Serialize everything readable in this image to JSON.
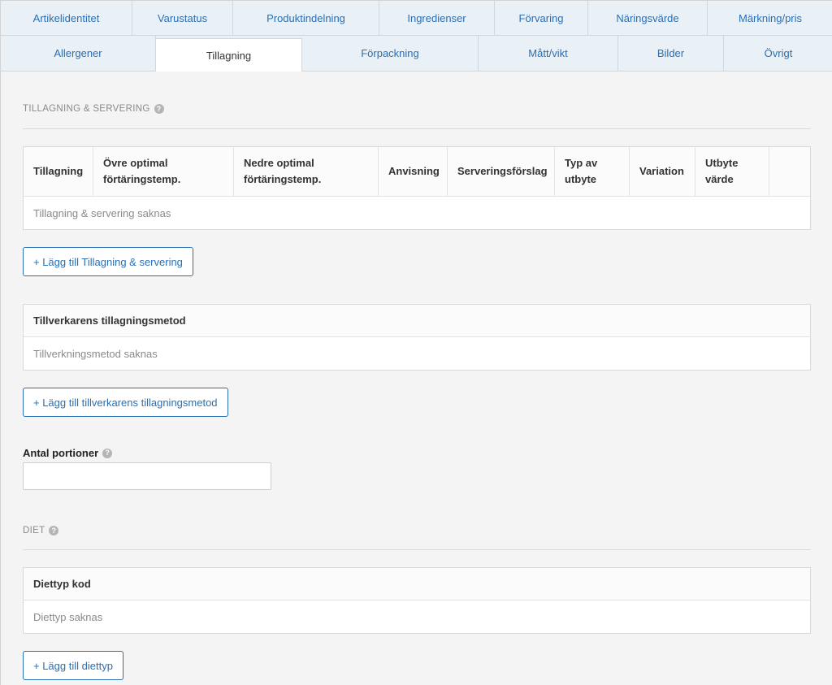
{
  "tabs": {
    "row1": [
      {
        "label": "Artikelidentitet"
      },
      {
        "label": "Varustatus"
      },
      {
        "label": "Produktindelning"
      },
      {
        "label": "Ingredienser"
      },
      {
        "label": "Förvaring"
      },
      {
        "label": "Näringsvärde"
      },
      {
        "label": "Märkning/pris"
      }
    ],
    "row2": [
      {
        "label": "Allergener"
      },
      {
        "label": "Tillagning"
      },
      {
        "label": "Förpackning"
      },
      {
        "label": "Mått/vikt"
      },
      {
        "label": "Bilder"
      },
      {
        "label": "Övrigt"
      }
    ],
    "active": "Tillagning"
  },
  "tillagning": {
    "section_title": "TILLAGNING & SERVERING",
    "columns": [
      {
        "line1": "Tillagning",
        "line2": ""
      },
      {
        "line1": "Övre optimal",
        "line2": "förtäringstemp."
      },
      {
        "line1": "Nedre optimal",
        "line2": "förtäringstemp."
      },
      {
        "line1": "Anvisning",
        "line2": ""
      },
      {
        "line1": "Serveringsförslag",
        "line2": ""
      },
      {
        "line1": "Typ av",
        "line2": "utbyte"
      },
      {
        "line1": "Variation",
        "line2": ""
      },
      {
        "line1": "Utbyte",
        "line2": "värde"
      },
      {
        "line1": "",
        "line2": ""
      }
    ],
    "empty_text": "Tillagning & servering saknas",
    "add_button": "+ Lägg till Tillagning & servering"
  },
  "tillverkare": {
    "header": "Tillverkarens tillagningsmetod",
    "empty_text": "Tillverkningsmetod saknas",
    "add_button": "+ Lägg till tillverkarens tillagningsmetod"
  },
  "portioner": {
    "label": "Antal portioner",
    "value": ""
  },
  "diet": {
    "section_title": "DIET",
    "header": "Diettyp kod",
    "empty_text": "Diettyp saknas",
    "add_button": "+ Lägg till diettyp"
  },
  "icons": {
    "help": "question-circle-icon"
  },
  "colors": {
    "accent": "#2a6fb3",
    "tab_bg": "#e9f0f6",
    "page_bg": "#f4f4f4"
  }
}
